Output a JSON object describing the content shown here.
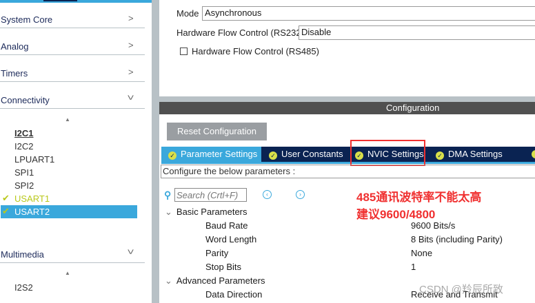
{
  "sidebar": {
    "categories": [
      {
        "label": "System Core",
        "icon": "chevron-right"
      },
      {
        "label": "Analog",
        "icon": "chevron-right"
      },
      {
        "label": "Timers",
        "icon": "chevron-right"
      },
      {
        "label": "Connectivity",
        "icon": "chevron-down"
      },
      {
        "label": "Multimedia",
        "icon": "chevron-down"
      }
    ],
    "connectivity_items": [
      "I2C1",
      "I2C2",
      "LPUART1",
      "SPI1",
      "SPI2",
      "USART1",
      "USART2"
    ],
    "multimedia_items": [
      "I2S2"
    ],
    "selected": "USART2"
  },
  "mode": {
    "mode_label": "Mode",
    "mode_value": "Asynchronous",
    "rs232_label": "Hardware Flow Control (RS232)",
    "rs232_value": "Disable",
    "rs485_label": "Hardware Flow Control (RS485)",
    "rs485_checked": false
  },
  "config": {
    "header": "Configuration",
    "reset_label": "Reset Configuration",
    "tabs": [
      "Parameter Settings",
      "User Constants",
      "NVIC Settings",
      "DMA Settings"
    ],
    "active_tab": "Parameter Settings",
    "hint": "Configure the below parameters :",
    "search_placeholder": "Search (Crtl+F)",
    "groups": [
      {
        "label": "Basic Parameters",
        "rows": [
          {
            "name": "Baud Rate",
            "value": "9600 Bits/s"
          },
          {
            "name": "Word Length",
            "value": "8 Bits (including Parity)"
          },
          {
            "name": "Parity",
            "value": "None"
          },
          {
            "name": "Stop Bits",
            "value": "1"
          }
        ]
      },
      {
        "label": "Advanced Parameters",
        "rows": [
          {
            "name": "Data Direction",
            "value": "Receive and Transmit"
          }
        ]
      }
    ]
  },
  "annotation": {
    "line1": "485通讯波特率不能太高",
    "line2": "建议9600/4800",
    "color": "#f03030"
  },
  "watermark": "CSDN @羚辰所致",
  "colors": {
    "accent": "#3aa8dc",
    "navy": "#0a2352",
    "check": "#b9c81a"
  }
}
